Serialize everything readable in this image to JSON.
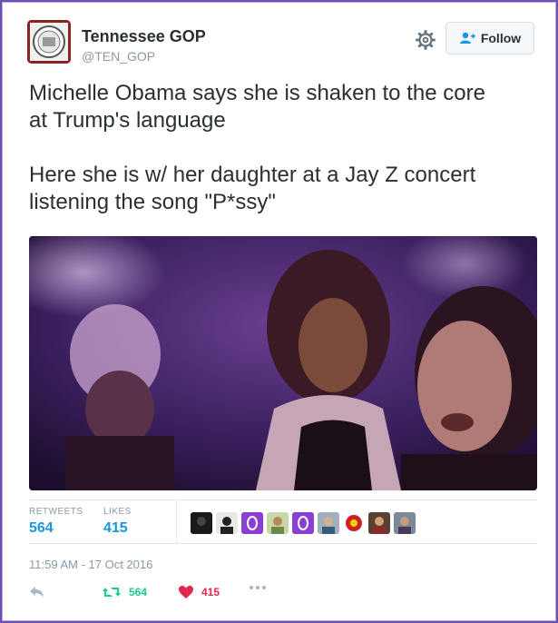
{
  "account": {
    "name": "Tennessee GOP",
    "handle": "@TEN_GOP"
  },
  "follow_label": "Follow",
  "tweet": {
    "text": "Michelle Obama says she is shaken to the core\nat Trump's language\n\nHere she is w/ her daughter at a Jay Z concert\nlistening the song \"P*ssy\""
  },
  "stats": {
    "retweets_label": "RETWEETS",
    "retweets_value": "564",
    "likes_label": "LIKES",
    "likes_value": "415"
  },
  "timestamp": "11:59 AM - 17 Oct 2016",
  "actions": {
    "retweet_count": "564",
    "like_count": "415"
  },
  "colors": {
    "retweet": "#19cf86",
    "like": "#e2264d",
    "link": "#1b95e0",
    "frame": "#6b4fb3"
  }
}
